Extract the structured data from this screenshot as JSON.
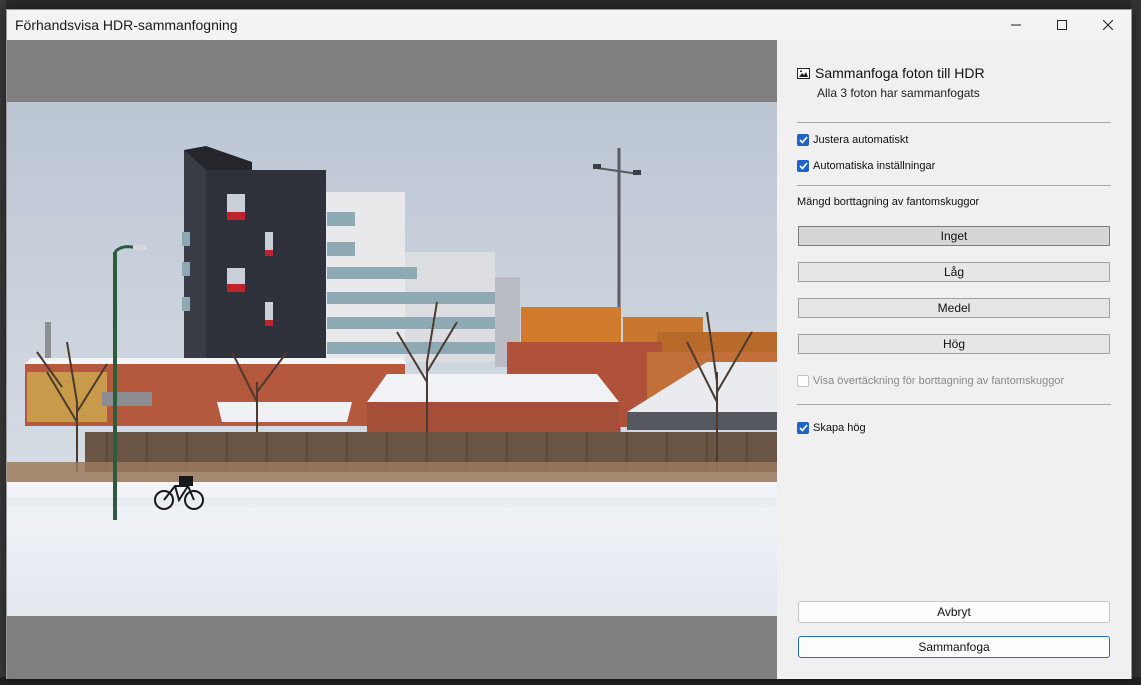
{
  "window": {
    "title": "Förhandsvisa HDR-sammanfogning"
  },
  "panel": {
    "heading": "Sammanfoga foton till HDR",
    "subheading": "Alla 3 foton har sammanfogats",
    "auto_align": {
      "label": "Justera automatiskt",
      "checked": true
    },
    "auto_settings": {
      "label": "Automatiska inställningar",
      "checked": true
    },
    "deghost": {
      "label": "Mängd borttagning av fantomskuggor",
      "options": [
        {
          "label": "Inget",
          "selected": true
        },
        {
          "label": "Låg",
          "selected": false
        },
        {
          "label": "Medel",
          "selected": false
        },
        {
          "label": "Hög",
          "selected": false
        }
      ],
      "overlay": {
        "label": "Visa övertäckning för borttagning av fantomskuggor",
        "checked": false,
        "enabled": false
      }
    },
    "create_stack": {
      "label": "Skapa hög",
      "checked": true
    },
    "cancel_label": "Avbryt",
    "merge_label": "Sammanfoga"
  },
  "colors": {
    "accent": "#1e64c8",
    "preview_bg": "#7f7f7f",
    "panel_bg": "#f0f0f0"
  }
}
